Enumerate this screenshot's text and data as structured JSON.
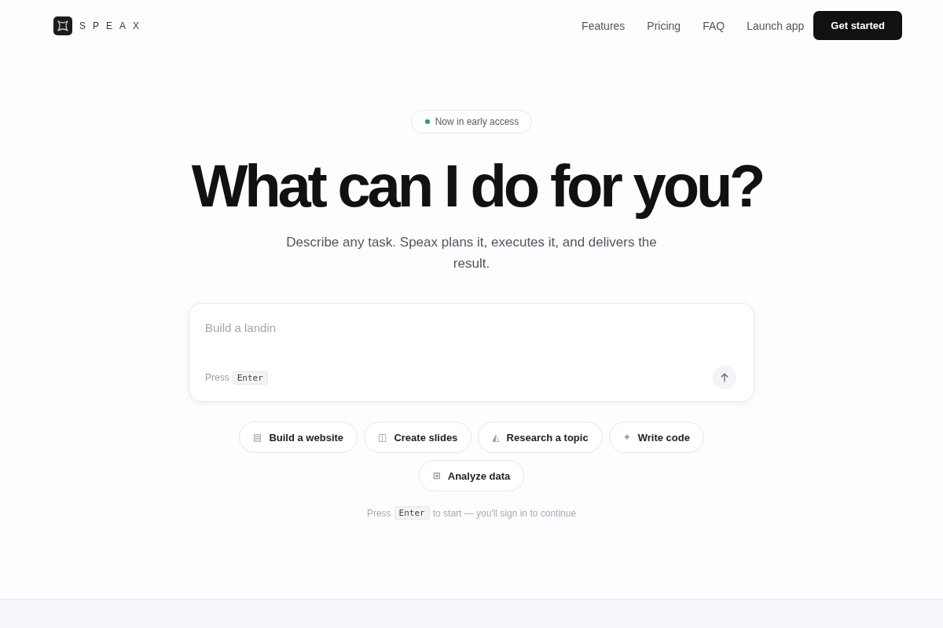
{
  "header": {
    "logo_text": "SPEAX",
    "nav": [
      "Features",
      "Pricing",
      "FAQ",
      "Launch app"
    ],
    "cta": "Get started"
  },
  "badge": {
    "label": "Now in early access"
  },
  "hero": {
    "title": "What can I do for you?",
    "subtitle": "Describe any task. Speax plans it, executes it, and delivers the result."
  },
  "prompt": {
    "placeholder": "Build a landin",
    "hint": "Press",
    "key": "Enter"
  },
  "suggestions": [
    {
      "icon": "▤",
      "label": "Build a website"
    },
    {
      "icon": "◫",
      "label": "Create slides"
    },
    {
      "icon": "◭",
      "label": "Research a topic"
    },
    {
      "icon": "✦",
      "label": "Write code"
    },
    {
      "icon": "⊞",
      "label": "Analyze data"
    }
  ],
  "footer_hint": {
    "before": "Press",
    "key": "Enter",
    "after": "to start — you'll sign in to continue"
  }
}
